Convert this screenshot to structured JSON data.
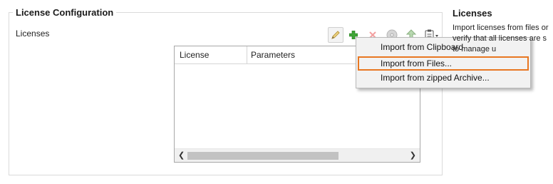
{
  "license_config": {
    "title": "License Configuration",
    "field_label": "Licenses",
    "table": {
      "columns": [
        "License",
        "Parameters"
      ]
    }
  },
  "toolbar": {
    "icons": [
      "pencil-icon",
      "add-icon",
      "delete-icon",
      "disc-icon",
      "upload-icon",
      "clipboard-icon"
    ]
  },
  "context_menu": {
    "items": [
      "Import from Clipboard",
      "Import from Files...",
      "Import from zipped Archive..."
    ],
    "highlighted_index": 1,
    "highlight_color": "#e87722"
  },
  "side_panel": {
    "title": "Licenses",
    "lines": [
      "Import licenses from files or",
      "verify that all licenses are s",
      "to manage u"
    ]
  }
}
